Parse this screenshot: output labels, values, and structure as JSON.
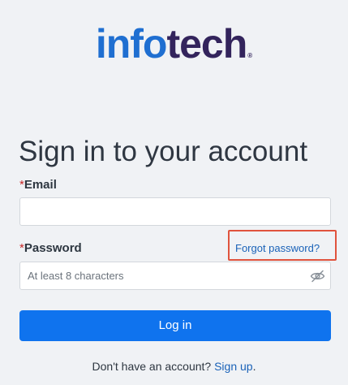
{
  "logo": {
    "part_info": "info",
    "part_tech": "tech",
    "registered_mark": "®",
    "colors": {
      "info": "#1f6fd1",
      "tech": "#33245c"
    }
  },
  "page_title": "Sign in to your account",
  "form": {
    "email": {
      "required_mark": "*",
      "label": "Email",
      "value": "",
      "placeholder": ""
    },
    "password": {
      "required_mark": "*",
      "label": "Password",
      "value": "",
      "placeholder": "At least 8 characters",
      "toggle_icon": "eye-slash-icon"
    },
    "forgot_password_link": "Forgot password?",
    "forgot_password_highlight_color": "#e0533d",
    "login_button": "Log in",
    "login_button_color": "#0f73ee"
  },
  "signup": {
    "prompt": "Don't have an account?",
    "link": "Sign up",
    "suffix": "."
  }
}
